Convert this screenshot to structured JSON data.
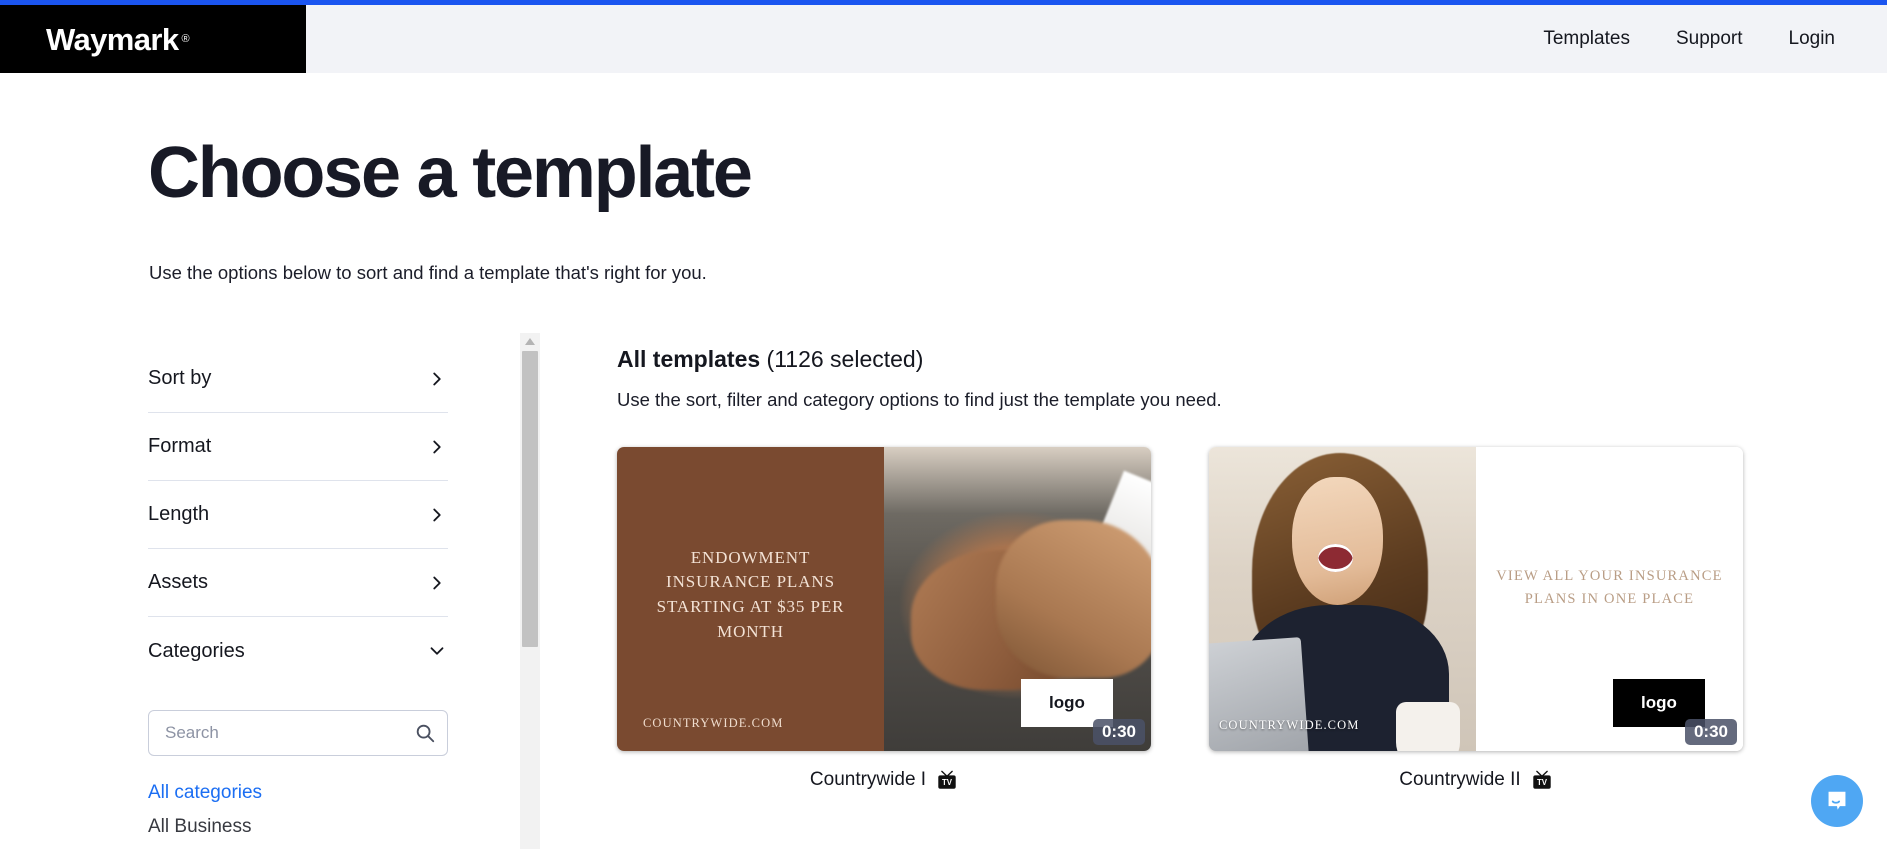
{
  "header": {
    "logo_text": "Waymark",
    "logo_registered": "®",
    "nav": [
      {
        "label": "Templates"
      },
      {
        "label": "Support"
      },
      {
        "label": "Login"
      }
    ]
  },
  "page": {
    "title": "Choose a template",
    "subtitle": "Use the options below to sort and find a template that's right for you."
  },
  "sidebar": {
    "filters": [
      {
        "label": "Sort by",
        "icon": "chevron-right-icon",
        "expanded": false
      },
      {
        "label": "Format",
        "icon": "chevron-right-icon",
        "expanded": false
      },
      {
        "label": "Length",
        "icon": "chevron-right-icon",
        "expanded": false
      },
      {
        "label": "Assets",
        "icon": "chevron-right-icon",
        "expanded": false
      },
      {
        "label": "Categories",
        "icon": "chevron-down-icon",
        "expanded": true
      }
    ],
    "search": {
      "placeholder": "Search",
      "value": "",
      "icon": "search-icon"
    },
    "categories": [
      {
        "label": "All categories",
        "selected": true
      },
      {
        "label": "All Business",
        "selected": false
      }
    ]
  },
  "results": {
    "heading_bold": "All templates",
    "heading_rest": " (1126 selected)",
    "count": 1126,
    "subtitle": "Use the sort, filter and category options to find just the template you need.",
    "templates": [
      {
        "name": "Countrywide I",
        "badge_icon": "tv-icon",
        "duration": "0:30",
        "logo_placeholder": "logo",
        "headline": "ENDOWMENT INSURANCE PLANS STARTING AT $35 PER MONTH",
        "brand_url": "COUNTRYWIDE.COM",
        "panel_color": "#7a4a30",
        "layout": "text-left-photo-right"
      },
      {
        "name": "Countrywide II",
        "badge_icon": "tv-icon",
        "duration": "0:30",
        "logo_placeholder": "logo",
        "headline": "VIEW ALL YOUR INSURANCE PLANS IN ONE PLACE",
        "brand_url": "COUNTRYWIDE.COM",
        "panel_color": "#ffffff",
        "layout": "photo-left-text-right"
      }
    ]
  },
  "chat": {
    "icon": "chat-bubble-icon",
    "color": "#4fa7f3"
  },
  "colors": {
    "accent_blue": "#1b55f0",
    "link_blue": "#1b6ef3",
    "header_bg": "#f2f3f7",
    "text_dark": "#15171f"
  }
}
